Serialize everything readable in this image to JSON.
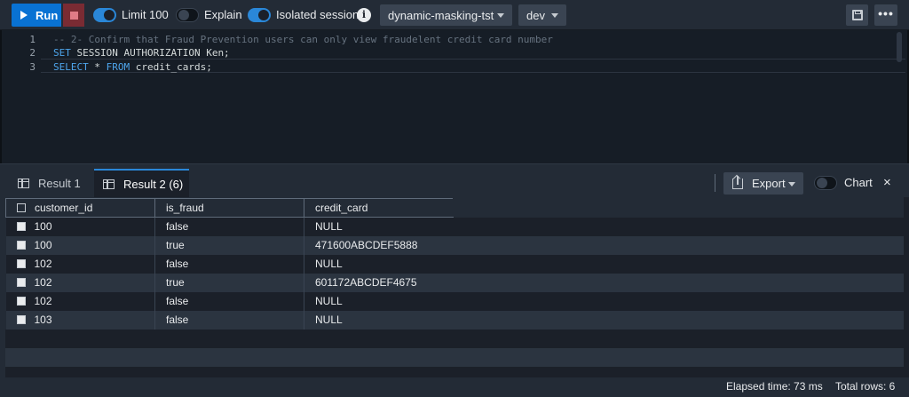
{
  "toolbar": {
    "run_label": "Run",
    "limit_label": "Limit 100",
    "limit_on": true,
    "explain_label": "Explain",
    "explain_on": false,
    "isolated_label": "Isolated session",
    "isolated_on": true,
    "info_glyph": "i",
    "database_select": "dynamic-masking-tst",
    "schema_select": "dev",
    "more_glyph": "•••"
  },
  "editor": {
    "lines": [
      {
        "num": "1",
        "comment": "-- 2- Confirm that Fraud Prevention users can only view fraudelent credit card number"
      },
      {
        "num": "2",
        "kw": "SET",
        "rest": " SESSION AUTHORIZATION Ken;"
      },
      {
        "num": "3",
        "kw": "SELECT",
        "rest": " * ",
        "kw2": "FROM",
        "rest2": " credit_cards;"
      }
    ]
  },
  "results": {
    "tabs": [
      {
        "label": "Result 1",
        "count": ""
      },
      {
        "label": "Result 2",
        "count": "(6)"
      }
    ],
    "export_label": "Export",
    "chart_label": "Chart",
    "close_glyph": "×",
    "columns": [
      "customer_id",
      "is_fraud",
      "credit_card"
    ],
    "rows": [
      [
        "100",
        "false",
        "NULL"
      ],
      [
        "100",
        "true",
        "471600ABCDEF5888"
      ],
      [
        "102",
        "false",
        "NULL"
      ],
      [
        "102",
        "true",
        "601172ABCDEF4675"
      ],
      [
        "102",
        "false",
        "NULL"
      ],
      [
        "103",
        "false",
        "NULL"
      ]
    ]
  },
  "status": {
    "elapsed": "Elapsed time: 73 ms",
    "total_rows": "Total rows: 6"
  }
}
